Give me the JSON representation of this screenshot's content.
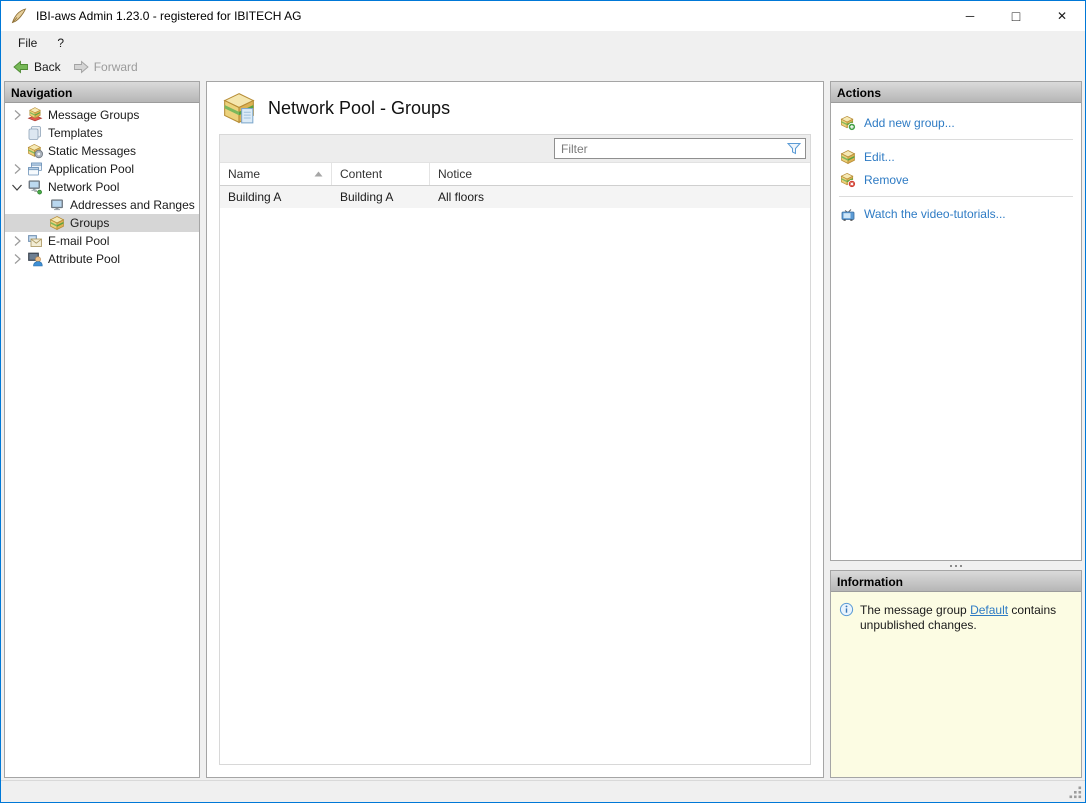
{
  "window": {
    "title": "IBI-aws Admin 1.23.0 - registered for IBITECH AG",
    "controls": {
      "minimize": "─",
      "maximize": "□",
      "close": "✕"
    }
  },
  "menu": {
    "items": [
      {
        "id": "file",
        "label": "File"
      },
      {
        "id": "help",
        "label": "?"
      }
    ]
  },
  "toolbar": {
    "back_label": "Back",
    "forward_label": "Forward"
  },
  "navigation": {
    "header": "Navigation",
    "items": [
      {
        "id": "message-groups",
        "label": "Message Groups",
        "icon": "message-groups",
        "level": 0,
        "chevron": "right",
        "selected": false
      },
      {
        "id": "templates",
        "label": "Templates",
        "icon": "templates",
        "level": 0,
        "chevron": "none",
        "selected": false
      },
      {
        "id": "static-messages",
        "label": "Static Messages",
        "icon": "static-messages",
        "level": 0,
        "chevron": "none",
        "selected": false
      },
      {
        "id": "application-pool",
        "label": "Application Pool",
        "icon": "application-pool",
        "level": 0,
        "chevron": "right",
        "selected": false
      },
      {
        "id": "network-pool",
        "label": "Network Pool",
        "icon": "network-pool",
        "level": 0,
        "chevron": "down",
        "selected": false
      },
      {
        "id": "addresses-and-ranges",
        "label": "Addresses and Ranges",
        "icon": "addresses-and-ranges",
        "level": 1,
        "chevron": "none",
        "selected": false
      },
      {
        "id": "groups",
        "label": "Groups",
        "icon": "groups",
        "level": 1,
        "chevron": "none",
        "selected": true
      },
      {
        "id": "e-mail-pool",
        "label": "E-mail Pool",
        "icon": "email-pool",
        "level": 0,
        "chevron": "right",
        "selected": false
      },
      {
        "id": "attribute-pool",
        "label": "Attribute Pool",
        "icon": "attribute-pool",
        "level": 0,
        "chevron": "right",
        "selected": false
      }
    ]
  },
  "content": {
    "title": "Network Pool - Groups",
    "title_icon": "network-groups",
    "filter": {
      "placeholder": "Filter",
      "icon": "filter-funnel"
    },
    "table": {
      "columns": [
        {
          "label": "Name",
          "sort": "asc",
          "width": 112
        },
        {
          "label": "Content",
          "sort": null,
          "width": 98
        },
        {
          "label": "Notice",
          "sort": null,
          "width": null
        }
      ],
      "rows": [
        [
          "Building A",
          "Building A",
          "All floors"
        ]
      ]
    }
  },
  "actions": {
    "header": "Actions",
    "items": [
      {
        "id": "add-new-group",
        "label": "Add new group...",
        "icon": "add-group",
        "separator_after": true
      },
      {
        "id": "edit",
        "label": "Edit...",
        "icon": "edit-group",
        "separator_after": false
      },
      {
        "id": "remove",
        "label": "Remove",
        "icon": "remove-group",
        "separator_after": true
      },
      {
        "id": "watch-video-tutorials",
        "label": "Watch the video-tutorials...",
        "icon": "video-tutorials",
        "separator_after": false
      }
    ]
  },
  "information": {
    "header": "Information",
    "message": {
      "before": "The message group ",
      "link": "Default",
      "after": " contains unpublished changes."
    }
  },
  "colors": {
    "window_border": "#0078d7",
    "link_blue": "#2e7bc4",
    "selection_gray": "#d6d6d6",
    "info_background": "#fcfce3",
    "panel_header_gradient_top": "#dadada",
    "panel_header_gradient_bottom": "#b6b6b6"
  }
}
